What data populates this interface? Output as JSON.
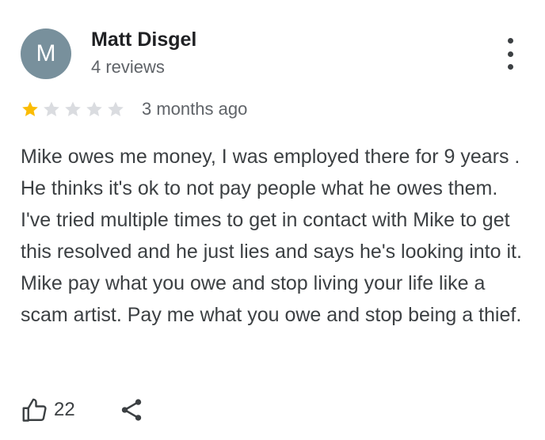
{
  "review": {
    "author": {
      "initial": "M",
      "name": "Matt Disgel",
      "reviews_count": "4 reviews",
      "avatar_color": "#78909c"
    },
    "rating": {
      "value": 1,
      "max": 5,
      "filled_color": "#fbbc04",
      "empty_color": "#dadce0"
    },
    "timestamp": "3 months ago",
    "text": "Mike owes me money, I was employed there for 9 years . He thinks it's ok to not pay people what he owes them. I've tried multiple times to get in contact with Mike to get this resolved and he just lies and says he's looking into it. Mike pay what you owe and stop living your life like a scam artist. Pay me what you owe and stop being a thief.",
    "actions": {
      "like_icon": "thumbs-up-icon",
      "like_count": "22",
      "share_icon": "share-icon",
      "more_icon": "more-vert-icon"
    }
  }
}
